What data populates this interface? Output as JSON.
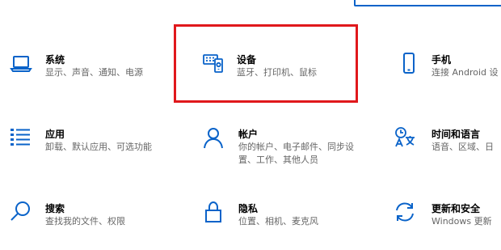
{
  "tiles": {
    "system": {
      "title": "系统",
      "desc": "显示、声音、通知、电源",
      "icon": "laptop-icon"
    },
    "devices": {
      "title": "设备",
      "desc": "蓝牙、打印机、鼠标",
      "icon": "devices-icon"
    },
    "phone": {
      "title": "手机",
      "desc": "连接 Android 设",
      "icon": "phone-icon"
    },
    "apps": {
      "title": "应用",
      "desc": "卸载、默认应用、可选功能",
      "icon": "apps-list-icon"
    },
    "accounts": {
      "title": "帐户",
      "desc_line1": "你的帐户、电子邮件、同步设",
      "desc_line2": "置、工作、其他人员",
      "icon": "person-icon"
    },
    "time_language": {
      "title": "时间和语言",
      "desc": "语音、区域、日",
      "icon": "time-language-icon"
    },
    "search": {
      "title": "搜索",
      "desc": "查找我的文件、权限",
      "icon": "search-icon"
    },
    "privacy": {
      "title": "隐私",
      "desc": "位置、相机、麦克风",
      "icon": "lock-icon"
    },
    "update_security": {
      "title": "更新和安全",
      "desc": "Windows 更新",
      "icon": "sync-icon"
    }
  },
  "colors": {
    "accent": "#0a63c9",
    "highlight": "#e0181c",
    "title_text": "#000000",
    "desc_text": "#666666"
  }
}
